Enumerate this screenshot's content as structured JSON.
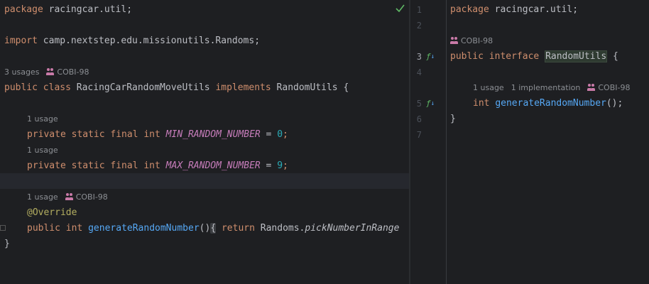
{
  "left": {
    "lines": {
      "package": [
        "package",
        " racingcar.util;"
      ],
      "import": [
        "import",
        " camp.nextstep.edu.missionutils.Randoms;"
      ],
      "class_decl": [
        "public",
        " ",
        "class",
        " RacingCarRandomMoveUtils ",
        "implements",
        " RandomUtils {"
      ],
      "min_decl": [
        "private static final int",
        " ",
        "MIN_RANDOM_NUMBER",
        " = ",
        "0",
        ";"
      ],
      "max_decl": [
        "private static final int",
        " ",
        "MAX_RANDOM_NUMBER",
        " = ",
        "9",
        ";"
      ],
      "override": "@Override",
      "method": [
        "public int",
        " ",
        "generateRandomNumber",
        "()",
        "{",
        " ",
        "return",
        " Randoms.",
        "pickNumberInRange"
      ],
      "close": "}"
    },
    "hints": {
      "class_usages": "3 usages",
      "class_author": "COBI-98",
      "min_usage": "1 usage",
      "max_usage": "1 usage",
      "method_usage": "1 usage",
      "method_author": "COBI-98"
    }
  },
  "gutter": {
    "line_numbers": [
      "1",
      "2",
      "3",
      "4",
      "5",
      "6",
      "7"
    ]
  },
  "right": {
    "lines": {
      "package": [
        "package",
        " racingcar.util;"
      ],
      "interface_decl": [
        "public",
        " ",
        "interface",
        " ",
        "RandomUtils",
        " {"
      ],
      "method": [
        "int",
        " ",
        "generateRandomNumber",
        "();"
      ],
      "close": "}"
    },
    "hints": {
      "interface_author": "COBI-98",
      "method_usage": "1 usage",
      "method_impl": "1 implementation",
      "method_author": "COBI-98"
    }
  }
}
